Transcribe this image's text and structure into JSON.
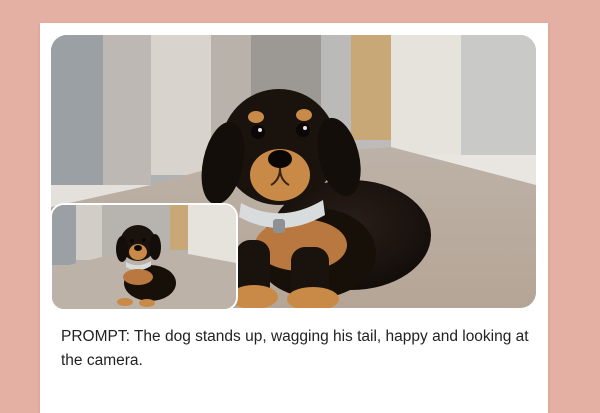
{
  "prompt": {
    "label": "PROMPT:",
    "text": "The dog stands up, wagging his tail, happy and looking at the camera."
  },
  "colors": {
    "page_background": "#e3b0a3",
    "card_background": "#ffffff",
    "text": "#222222",
    "dog_coat": "#17110e",
    "dog_tan": "#c98a47",
    "collar": "#d9dcdc",
    "carpet": "#c2b3a4"
  },
  "media": {
    "main_image": "photo of a black and tan puppy lying on carpet in a hallway",
    "reference_thumbnail": "smaller copy of the puppy photo"
  }
}
